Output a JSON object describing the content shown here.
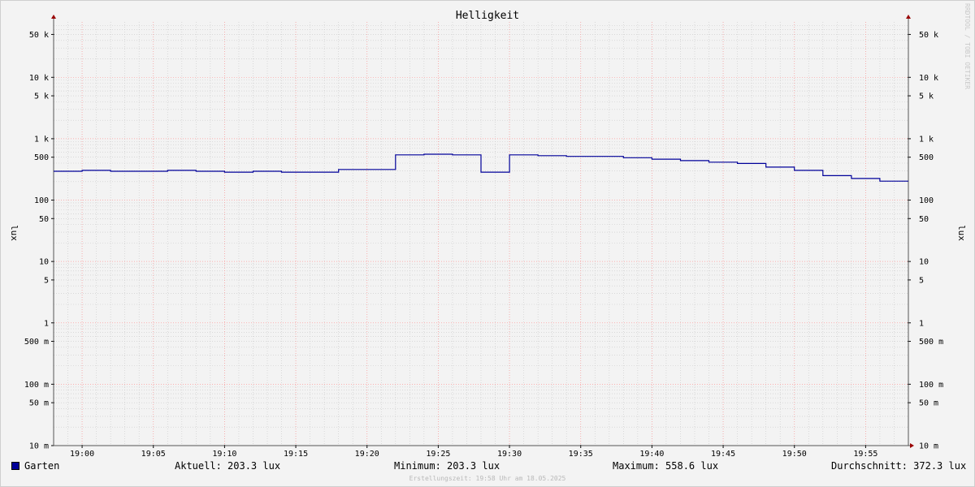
{
  "chart_data": {
    "type": "line",
    "title": "Helligkeit",
    "ylabel": "lux",
    "y_scale": "log",
    "ylim": [
      0.01,
      80000
    ],
    "xlim": [
      "18:58",
      "19:58"
    ],
    "grid": true,
    "y_ticks": [
      {
        "value": 50000,
        "label": "50 k"
      },
      {
        "value": 10000,
        "label": "10 k"
      },
      {
        "value": 5000,
        "label": "5 k"
      },
      {
        "value": 1000,
        "label": "1 k"
      },
      {
        "value": 500,
        "label": "500"
      },
      {
        "value": 100,
        "label": "100"
      },
      {
        "value": 50,
        "label": "50"
      },
      {
        "value": 10,
        "label": "10"
      },
      {
        "value": 5,
        "label": "5"
      },
      {
        "value": 1,
        "label": "1"
      },
      {
        "value": 0.5,
        "label": "500 m"
      },
      {
        "value": 0.1,
        "label": "100 m"
      },
      {
        "value": 0.05,
        "label": "50 m"
      },
      {
        "value": 0.01,
        "label": "10 m"
      }
    ],
    "x_ticks": [
      "19:00",
      "19:05",
      "19:10",
      "19:15",
      "19:20",
      "19:25",
      "19:30",
      "19:35",
      "19:40",
      "19:45",
      "19:50",
      "19:55"
    ],
    "series": [
      {
        "name": "Garten",
        "color": "#000099",
        "x": [
          "18:58",
          "19:00",
          "19:02",
          "19:04",
          "19:06",
          "19:08",
          "19:10",
          "19:12",
          "19:14",
          "19:16",
          "19:18",
          "19:20",
          "19:22",
          "19:24",
          "19:26",
          "19:28",
          "19:30",
          "19:32",
          "19:34",
          "19:36",
          "19:38",
          "19:40",
          "19:42",
          "19:44",
          "19:46",
          "19:48",
          "19:50",
          "19:52",
          "19:54",
          "19:56"
        ],
        "values": [
          295,
          305,
          295,
          295,
          305,
          295,
          285,
          295,
          285,
          285,
          315,
          315,
          545,
          558.6,
          545,
          285,
          545,
          530,
          515,
          515,
          490,
          465,
          440,
          415,
          395,
          345,
          305,
          250,
          225,
          203.3
        ]
      }
    ]
  },
  "legend": {
    "series_name": "Garten",
    "current": "Aktuell: 203.3 lux",
    "minimum": "Minimum: 203.3 lux",
    "maximum": "Maximum: 558.6 lux",
    "average": "Durchschnitt: 372.3 lux"
  },
  "watermark": "RRDTOOL / TOBI OETIKER",
  "footer": "Erstellungszeit: 19:58 Uhr am 18.05.2025",
  "colors": {
    "series": "#000099",
    "major_grid": "#ff9a9a",
    "minor_grid": "#c8c8c8",
    "axis_arrow": "#990000"
  }
}
